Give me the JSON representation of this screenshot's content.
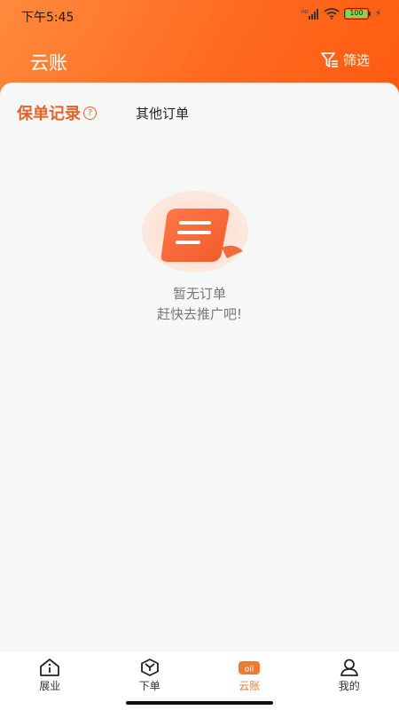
{
  "status_bar": {
    "time": "下午5:45",
    "battery": "100"
  },
  "header": {
    "title": "云账",
    "filter_label": "筛选"
  },
  "tabs": {
    "active_label": "保单记录",
    "other_label": "其他订单"
  },
  "empty_state": {
    "title": "暂无订单",
    "subtitle": "赶快去推广吧!"
  },
  "tabbar": {
    "items": [
      {
        "label": "展业",
        "icon": "home-info-icon"
      },
      {
        "label": "下单",
        "icon": "box-icon"
      },
      {
        "label": "云账",
        "icon": "oil-card-icon",
        "active": true
      },
      {
        "label": "我的",
        "icon": "user-icon"
      }
    ]
  },
  "colors": {
    "accent": "#f07a30",
    "header": "#ff6a1f"
  }
}
